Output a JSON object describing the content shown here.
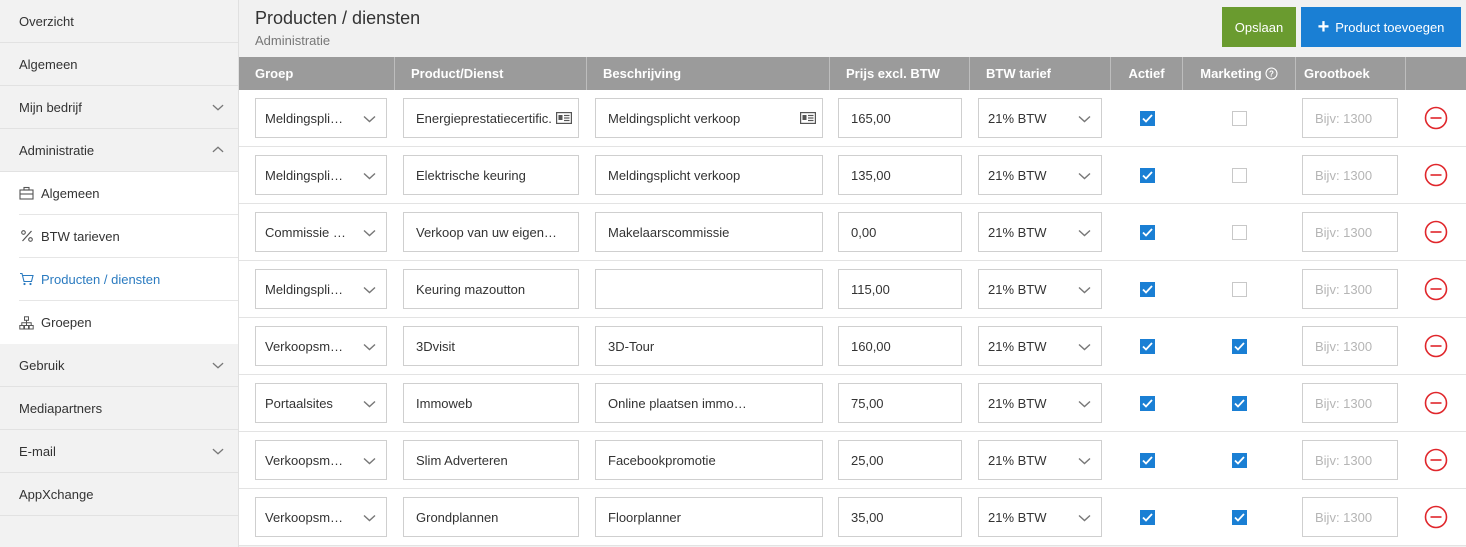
{
  "sidebar": {
    "items": [
      {
        "label": "Overzicht",
        "chevron": false
      },
      {
        "label": "Algemeen",
        "chevron": false
      },
      {
        "label": "Mijn bedrijf",
        "chevron": "down"
      },
      {
        "label": "Administratie",
        "chevron": "up"
      }
    ],
    "sub_items": [
      {
        "label": "Algemeen",
        "icon": "briefcase-icon",
        "active": false
      },
      {
        "label": "BTW tarieven",
        "icon": "percent-icon",
        "active": false
      },
      {
        "label": "Producten / diensten",
        "icon": "cart-icon",
        "active": true
      },
      {
        "label": "Groepen",
        "icon": "hierarchy-icon",
        "active": false
      }
    ],
    "items_after": [
      {
        "label": "Gebruik",
        "chevron": "down"
      },
      {
        "label": "Mediapartners",
        "chevron": false
      },
      {
        "label": "E-mail",
        "chevron": "down"
      },
      {
        "label": "AppXchange",
        "chevron": false
      }
    ]
  },
  "header": {
    "title": "Producten / diensten",
    "subtitle": "Administratie",
    "save_label": "Opslaan",
    "add_label": "Product toevoegen"
  },
  "colors": {
    "save": "#6a9b2f",
    "add": "#1a7fd4",
    "accent": "#2b7bc0",
    "delete": "#e0262b"
  },
  "table": {
    "columns": [
      "Groep",
      "Product/Dienst",
      "Beschrijving",
      "Prijs excl. BTW",
      "BTW tarief",
      "Actief",
      "Marketing",
      "Grootboek"
    ],
    "grootboek_placeholder": "Bijv: 1300",
    "rows": [
      {
        "groep": "Meldingspli…",
        "product": "Energieprestatiecertific.",
        "product_card": true,
        "beschrijving": "Meldingsplicht verkoop",
        "desc_card": true,
        "prijs": "165,00",
        "btw": "21% BTW",
        "actief": true,
        "marketing": false
      },
      {
        "groep": "Meldingspli…",
        "product": "Elektrische keuring",
        "product_card": false,
        "beschrijving": "Meldingsplicht verkoop",
        "desc_card": false,
        "prijs": "135,00",
        "btw": "21% BTW",
        "actief": true,
        "marketing": false
      },
      {
        "groep": "Commissie …",
        "product": "Verkoop van uw eigen…",
        "product_card": false,
        "beschrijving": "Makelaarscommissie",
        "desc_card": false,
        "prijs": "0,00",
        "btw": "21% BTW",
        "actief": true,
        "marketing": false
      },
      {
        "groep": "Meldingspli…",
        "product": "Keuring mazoutton",
        "product_card": false,
        "beschrijving": "",
        "desc_card": false,
        "prijs": "115,00",
        "btw": "21% BTW",
        "actief": true,
        "marketing": false
      },
      {
        "groep": "Verkoopsm…",
        "product": "3Dvisit",
        "product_card": false,
        "beschrijving": "3D-Tour",
        "desc_card": false,
        "prijs": "160,00",
        "btw": "21% BTW",
        "actief": true,
        "marketing": true
      },
      {
        "groep": "Portaalsites",
        "product": "Immoweb",
        "product_card": false,
        "beschrijving": "Online plaatsen immoweb",
        "desc_card": false,
        "prijs": "75,00",
        "btw": "21% BTW",
        "actief": true,
        "marketing": true
      },
      {
        "groep": "Verkoopsm…",
        "product": "Slim Adverteren",
        "product_card": false,
        "beschrijving": "Facebookpromotie",
        "desc_card": false,
        "prijs": "25,00",
        "btw": "21% BTW",
        "actief": true,
        "marketing": true
      },
      {
        "groep": "Verkoopsm…",
        "product": "Grondplannen",
        "product_card": false,
        "beschrijving": "Floorplanner",
        "desc_card": false,
        "prijs": "35,00",
        "btw": "21% BTW",
        "actief": true,
        "marketing": true
      }
    ]
  }
}
